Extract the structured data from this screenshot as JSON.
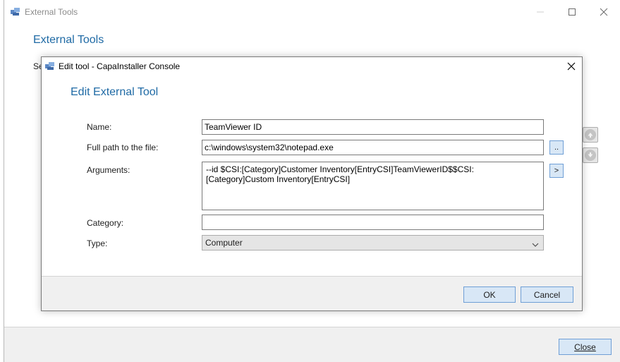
{
  "outer_window": {
    "title": "External Tools",
    "heading": "External Tools",
    "partial_label": "Se",
    "close_button": "Close",
    "controls": {
      "minimize": "minimize-icon",
      "maximize": "maximize-icon",
      "close": "close-icon"
    },
    "side_buttons": [
      "move-up-icon",
      "move-down-icon"
    ]
  },
  "dialog": {
    "title": "Edit tool - CapaInstaller Console",
    "heading": "Edit External Tool",
    "fields": {
      "name": {
        "label": "Name:",
        "value": "TeamViewer ID"
      },
      "path": {
        "label": "Full path to the file:",
        "value": "c:\\windows\\system32\\notepad.exe",
        "browse_label": ".."
      },
      "arguments": {
        "label": "Arguments:",
        "value": "--id $CSI:[Category]Customer Inventory[EntryCSI]TeamViewerID$$CSI:[Category]Custom Inventory[EntryCSI]",
        "insert_label": ">"
      },
      "category": {
        "label": "Category:",
        "value": ""
      },
      "type": {
        "label": "Type:",
        "value": "Computer"
      }
    },
    "buttons": {
      "ok": "OK",
      "cancel": "Cancel"
    }
  },
  "colors": {
    "heading": "#1f6aa5",
    "button_fill": "#d8e7f6",
    "button_border": "#6f9fd6",
    "footer": "#f0f0f0"
  }
}
